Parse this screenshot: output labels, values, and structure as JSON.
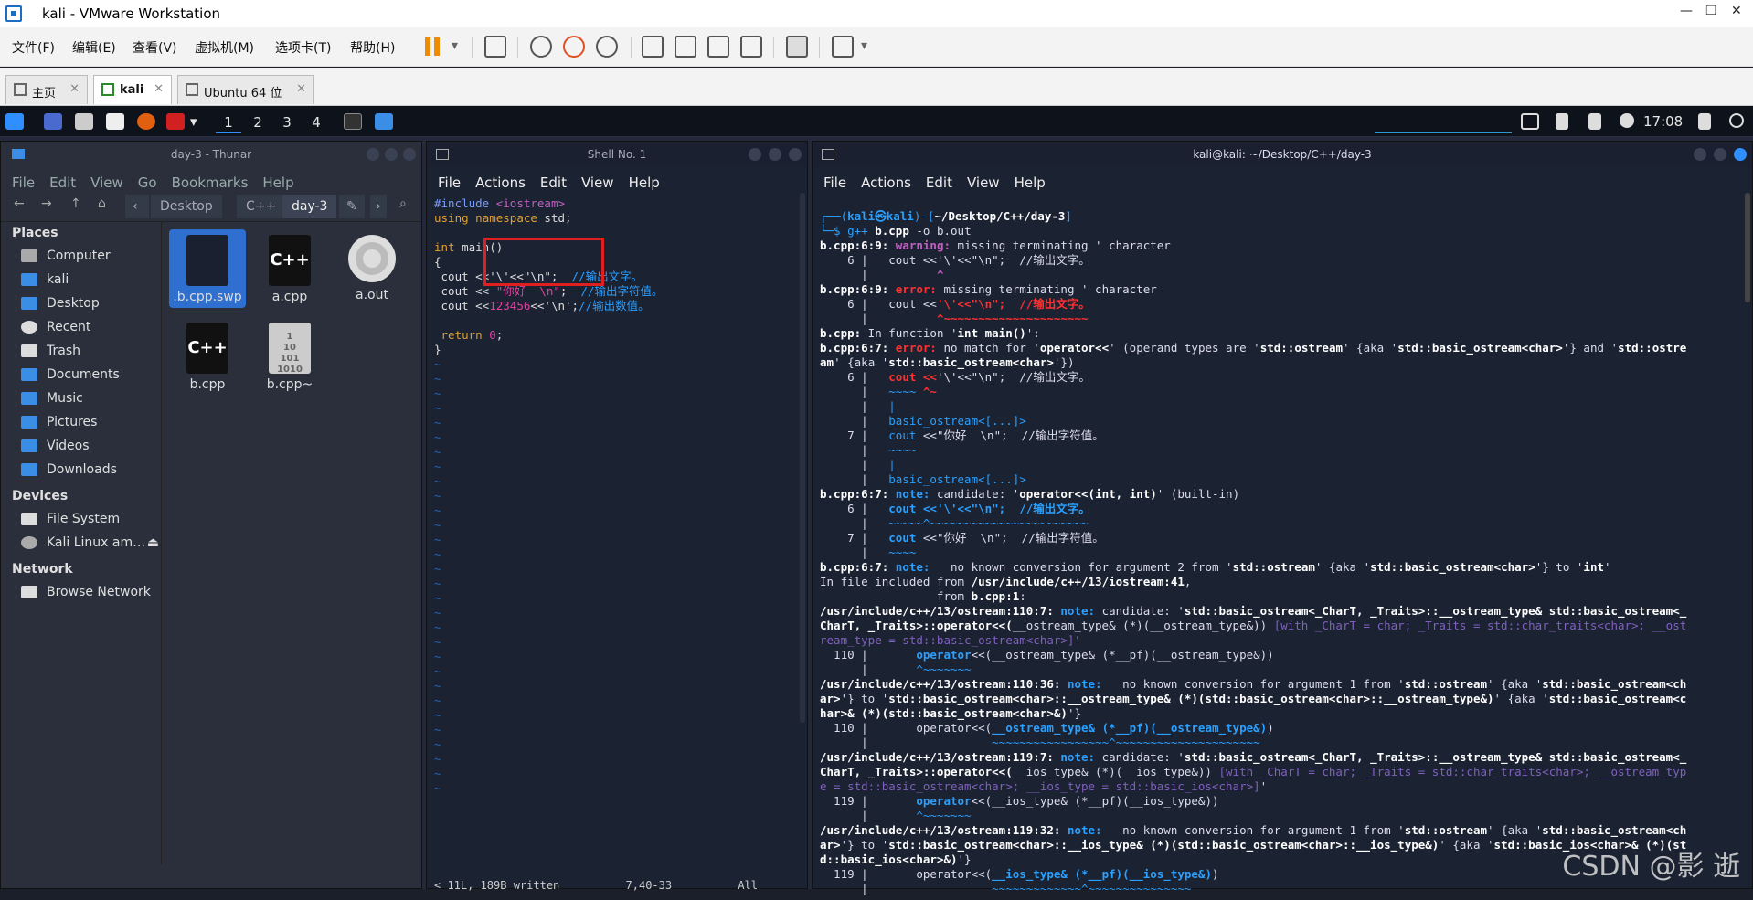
{
  "window": {
    "title": "kali - VMware Workstation"
  },
  "menu": [
    "文件(F)",
    "编辑(E)",
    "查看(V)",
    "虚拟机(M)",
    "选项卡(T)",
    "帮助(H)"
  ],
  "tabs": [
    "主页",
    "kali",
    "Ubuntu 64 位"
  ],
  "panel": {
    "workspaces": [
      "1",
      "2",
      "3",
      "4"
    ],
    "time": "17:08"
  },
  "thunar": {
    "title": "day-3 - Thunar",
    "menu": [
      "File",
      "Edit",
      "View",
      "Go",
      "Bookmarks",
      "Help"
    ],
    "crumbs": [
      "Desktop",
      "C++",
      "day-3"
    ],
    "places_header": "Places",
    "places": [
      "Computer",
      "kali",
      "Desktop",
      "Recent",
      "Trash",
      "Documents",
      "Music",
      "Pictures",
      "Videos",
      "Downloads"
    ],
    "devices_header": "Devices",
    "devices": [
      "File System",
      "Kali Linux am…"
    ],
    "network_header": "Network",
    "network": [
      "Browse Network"
    ],
    "files": [
      ".b.cpp.swp",
      "a.cpp",
      "a.out",
      "b.cpp",
      "b.cpp~"
    ]
  },
  "shell1": {
    "title": "Shell No. 1",
    "menu": [
      "File",
      "Actions",
      "Edit",
      "View",
      "Help"
    ],
    "status": "< 11L, 189B written          7,40-33          All"
  },
  "shell2": {
    "title": "kali@kali: ~/Desktop/C++/day-3",
    "menu": [
      "File",
      "Actions",
      "Edit",
      "View",
      "Help"
    ]
  },
  "watermark": "CSDN @影 逝"
}
